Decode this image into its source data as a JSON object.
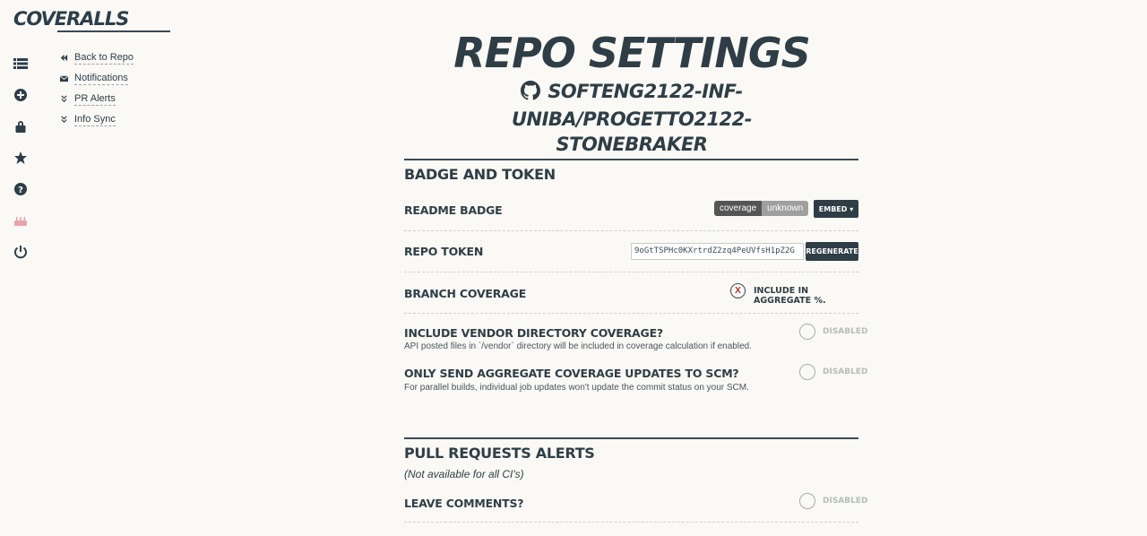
{
  "brand": {
    "logo_text": "COVERALLS"
  },
  "rail_icons": [
    "list-icon",
    "add-circle-icon",
    "lock-icon",
    "star-icon",
    "help-icon",
    "cake-icon",
    "power-icon"
  ],
  "subnav": [
    {
      "label": "Back to Repo",
      "icon": "double-chevron-left-icon"
    },
    {
      "label": "Notifications",
      "icon": "envelope-icon"
    },
    {
      "label": "PR Alerts",
      "icon": "double-chevron-down-icon"
    },
    {
      "label": "Info Sync",
      "icon": "double-chevron-down-icon"
    }
  ],
  "page": {
    "title": "REPO SETTINGS",
    "repo_line1": "SOFTENG2122-INF-UNIBA/PROGETTO2122-",
    "repo_line2": "STONEBRAKER"
  },
  "badge_and_token": {
    "title": "BADGE AND TOKEN",
    "readme_badge_label": "README BADGE",
    "badge_left": "coverage",
    "badge_right": "unknown",
    "embed_label": "EMBED ▾",
    "repo_token_label": "REPO TOKEN",
    "repo_token_value": "9oGtTSPHc0KXrtrdZ2zq4PeUVfsH1pZ2G",
    "regenerate_label": "REGENERATE",
    "branch_coverage_label": "BRANCH COVERAGE",
    "branch_coverage_mark": "X",
    "include_aggregate_label": "INCLUDE IN AGGREGATE %.",
    "vendor_label": "INCLUDE VENDOR DIRECTORY COVERAGE?",
    "vendor_desc": "API posted files in `/vendor` directory will be included in coverage calculation if enabled.",
    "vendor_status": "DISABLED",
    "aggregate_label": "ONLY SEND AGGREGATE COVERAGE UPDATES TO SCM?",
    "aggregate_desc": "For parallel builds, individual job updates won't update the commit status on your SCM.",
    "aggregate_status": "DISABLED"
  },
  "pull_requests": {
    "title": "PULL REQUESTS ALERTS",
    "note": "(Not available for all CI's)",
    "leave_comments_label": "LEAVE COMMENTS?",
    "leave_comments_status": "DISABLED"
  }
}
